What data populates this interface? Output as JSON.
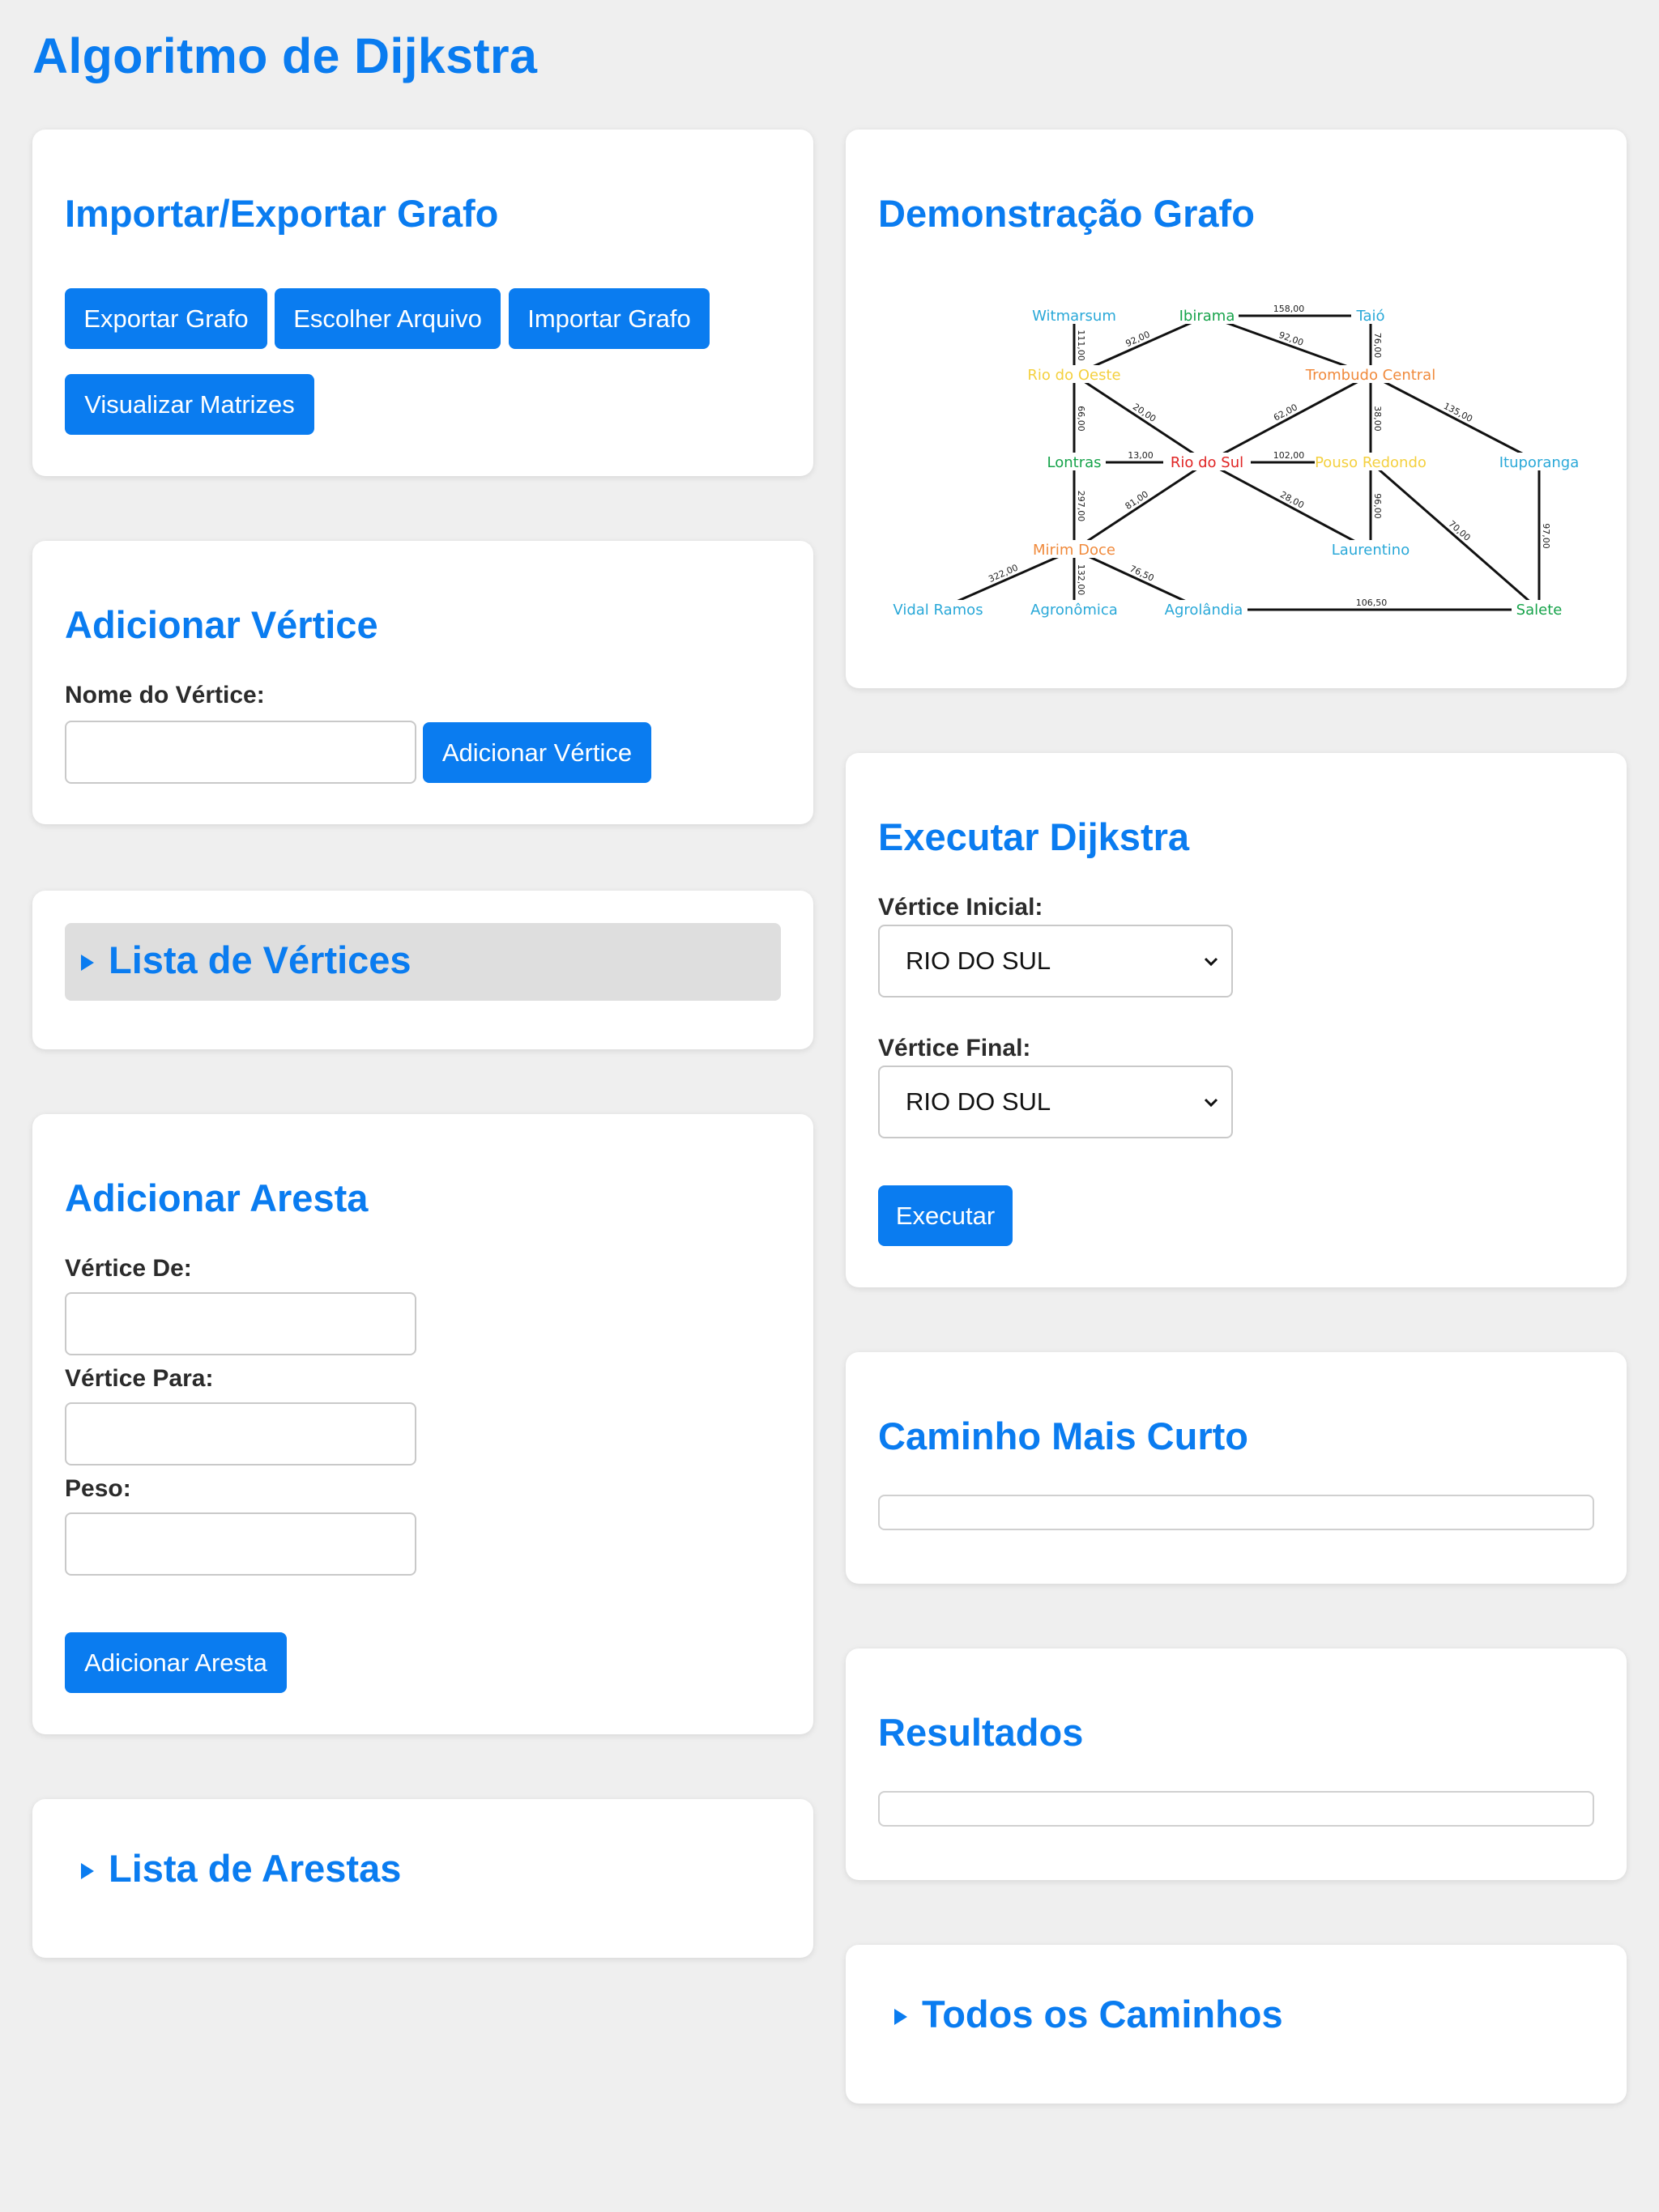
{
  "title": "Algoritmo de Dijkstra",
  "import_export": {
    "heading": "Importar/Exportar Grafo",
    "export_label": "Exportar Grafo",
    "choose_label": "Escolher Arquivo",
    "import_label": "Importar Grafo",
    "matrices_label": "Visualizar Matrizes"
  },
  "add_vertex": {
    "heading": "Adicionar Vértice",
    "name_label": "Nome do Vértice:",
    "name_value": "",
    "button_label": "Adicionar Vértice"
  },
  "vertex_list": {
    "summary": "Lista de Vértices"
  },
  "add_edge": {
    "heading": "Adicionar Aresta",
    "from_label": "Vértice De:",
    "to_label": "Vértice Para:",
    "weight_label": "Peso:",
    "button_label": "Adicionar Aresta"
  },
  "edge_list": {
    "summary": "Lista de Arestas"
  },
  "graph_demo": {
    "heading": "Demonstração Grafo",
    "nodes": [
      {
        "id": "witmarsum",
        "label": "Witmarsum",
        "color": "#29a8d8"
      },
      {
        "id": "ibirama",
        "label": "Ibirama",
        "color": "#16a34a"
      },
      {
        "id": "taio",
        "label": "Taió",
        "color": "#29a8d8"
      },
      {
        "id": "riooeste",
        "label": "Rio do Oeste",
        "color": "#f4d03f"
      },
      {
        "id": "trombudo",
        "label": "Trombudo Central",
        "color": "#f08a3c"
      },
      {
        "id": "lontras",
        "label": "Lontras",
        "color": "#16a34a"
      },
      {
        "id": "riodosul",
        "label": "Rio do Sul",
        "color": "#e02424"
      },
      {
        "id": "pouso",
        "label": "Pouso Redondo",
        "color": "#f4d03f"
      },
      {
        "id": "ituporanga",
        "label": "Ituporanga",
        "color": "#29a8d8"
      },
      {
        "id": "mirim",
        "label": "Mirim Doce",
        "color": "#f08a3c"
      },
      {
        "id": "laurentino",
        "label": "Laurentino",
        "color": "#29a8d8"
      },
      {
        "id": "vidal",
        "label": "Vidal Ramos",
        "color": "#29a8d8"
      },
      {
        "id": "agronomica",
        "label": "Agronômica",
        "color": "#29a8d8"
      },
      {
        "id": "agrolandia",
        "label": "Agrolândia",
        "color": "#29a8d8"
      },
      {
        "id": "salete",
        "label": "Salete",
        "color": "#16a34a"
      }
    ],
    "edges": [
      {
        "from": "ibirama",
        "to": "taio",
        "weight": "158,00"
      },
      {
        "from": "witmarsum",
        "to": "riooeste",
        "weight": "111,00"
      },
      {
        "from": "riooeste",
        "to": "ibirama",
        "weight": "92,00"
      },
      {
        "from": "ibirama",
        "to": "trombudo",
        "weight": "92,00"
      },
      {
        "from": "taio",
        "to": "trombudo",
        "weight": "76,00"
      },
      {
        "from": "riooeste",
        "to": "riodosul",
        "weight": "20,00"
      },
      {
        "from": "riooeste",
        "to": "lontras",
        "weight": "66,00"
      },
      {
        "from": "trombudo",
        "to": "riodosul",
        "weight": "62,00"
      },
      {
        "from": "trombudo",
        "to": "pouso",
        "weight": "38,00"
      },
      {
        "from": "trombudo",
        "to": "ituporanga",
        "weight": "135,00"
      },
      {
        "from": "lontras",
        "to": "riodosul",
        "weight": "13,00"
      },
      {
        "from": "riodosul",
        "to": "pouso",
        "weight": "102,00"
      },
      {
        "from": "riodosul",
        "to": "laurentino",
        "weight": "28,00"
      },
      {
        "from": "riodosul",
        "to": "mirim",
        "weight": "81,00"
      },
      {
        "from": "lontras",
        "to": "mirim",
        "weight": "297,00"
      },
      {
        "from": "pouso",
        "to": "laurentino",
        "weight": "96,00"
      },
      {
        "from": "pouso",
        "to": "salete",
        "weight": "70,00"
      },
      {
        "from": "ituporanga",
        "to": "salete",
        "weight": "97,00"
      },
      {
        "from": "mirim",
        "to": "vidal",
        "weight": "322,00"
      },
      {
        "from": "mirim",
        "to": "agronomica",
        "weight": "132,00"
      },
      {
        "from": "mirim",
        "to": "agrolandia",
        "weight": "76,50"
      },
      {
        "from": "agrolandia",
        "to": "salete",
        "weight": "106,50"
      }
    ]
  },
  "run": {
    "heading": "Executar Dijkstra",
    "start_label": "Vértice Inicial:",
    "start_value": "RIO DO SUL",
    "end_label": "Vértice Final:",
    "end_value": "RIO DO SUL",
    "button_label": "Executar"
  },
  "shortest": {
    "heading": "Caminho Mais Curto",
    "value": ""
  },
  "results": {
    "heading": "Resultados",
    "value": ""
  },
  "all_paths": {
    "summary": "Todos os Caminhos"
  },
  "colors": {
    "accent": "#0a7cf0",
    "background": "#efefef",
    "card": "#ffffff"
  }
}
